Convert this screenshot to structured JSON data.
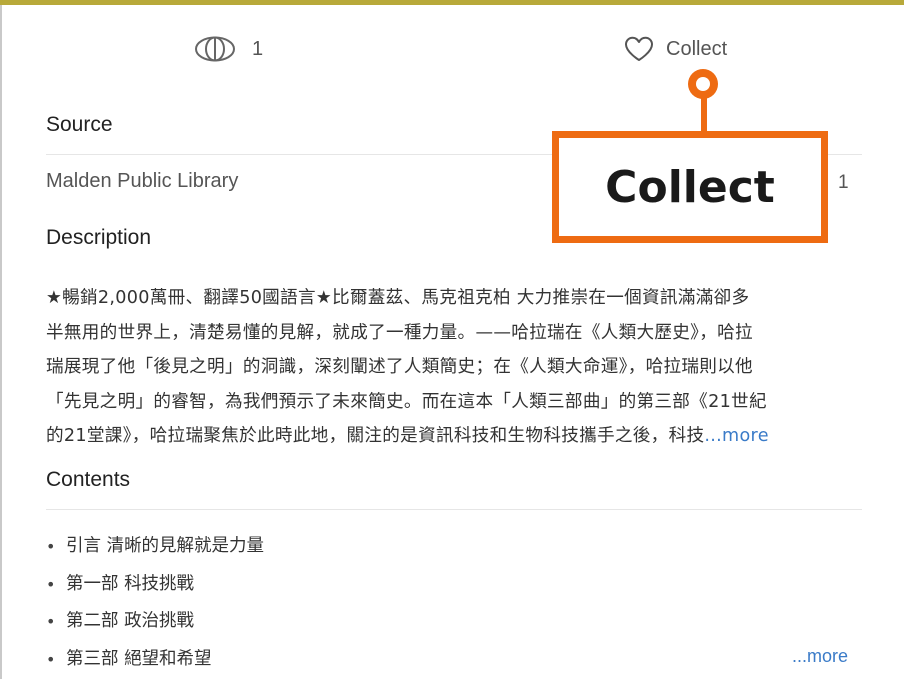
{
  "actions": {
    "views_count": "1",
    "collect_label": "Collect"
  },
  "source": {
    "title": "Source",
    "library": "Malden Public Library",
    "count": "1"
  },
  "description": {
    "title": "Description",
    "lines": [
      "★暢銷2,000萬冊、翻譯50國語言★比爾蓋茲、馬克祖克柏 大力推崇在一個資訊滿滿卻多",
      "半無用的世界上，清楚易懂的見解，就成了一種力量。——哈拉瑞在《人類大歷史》，哈拉",
      "瑞展現了他「後見之明」的洞識，深刻闡述了人類簡史；在《人類大命運》，哈拉瑞則以他",
      "「先見之明」的睿智，為我們預示了未來簡史。而在這本「人類三部曲」的第三部《21世紀",
      "的21堂課》，哈拉瑞聚焦於此時此地，關注的是資訊科技和生物科技攜手之後，科技"
    ],
    "more": "...more"
  },
  "contents": {
    "title": "Contents",
    "items": [
      "引言 清晰的見解就是力量",
      "第一部 科技挑戰",
      "第二部 政治挑戰",
      "第三部 絕望和希望"
    ],
    "more": "...more"
  },
  "callout": {
    "label": "Collect"
  },
  "icons": {
    "views": "views-icon",
    "collect": "heart-icon"
  },
  "colors": {
    "accent_orange": "#ee6b12",
    "link_blue": "#3a7bc8",
    "top_border": "#b8a93a"
  }
}
